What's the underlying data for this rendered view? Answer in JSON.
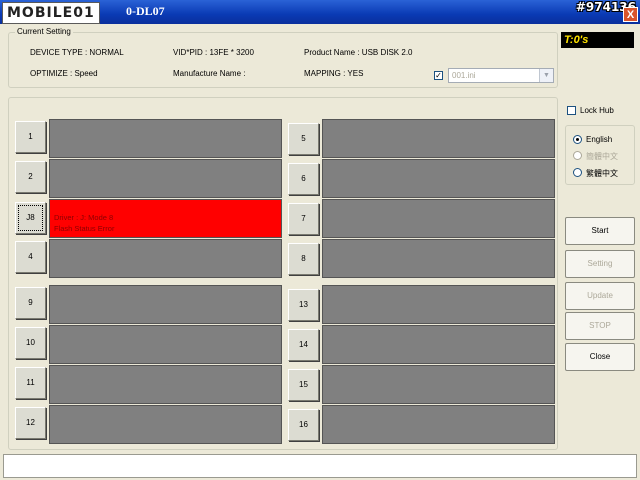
{
  "titlebar": {
    "logo_text": "MOBILE01",
    "title": "0-DL07",
    "watermark": "#974136",
    "close_label": "X"
  },
  "current_setting": {
    "legend": "Current Setting",
    "device_type": "DEVICE TYPE : NORMAL",
    "vid_pid": "VID*PID : 13FE * 3200",
    "product_name": "Product Name : USB DISK 2.0",
    "optimize": "OPTIMIZE : Speed",
    "manufacture": "Manufacture Name :",
    "mapping": "MAPPING : YES",
    "ini_checked": true,
    "ini_check_mark": "✓",
    "ini_file": "001.ini",
    "combo_arrow": "▼"
  },
  "timer": "T:0's",
  "ports_left": [
    {
      "label": "1",
      "status_lines": [
        "",
        ""
      ]
    },
    {
      "label": "2",
      "status_lines": [
        "",
        ""
      ]
    },
    {
      "label": "J8",
      "status_lines": [
        "Driver : J: Mode 8",
        "Flash Status Error"
      ],
      "error": true
    },
    {
      "label": "4",
      "status_lines": [
        "",
        ""
      ]
    },
    {
      "label": "9",
      "status_lines": [
        "",
        ""
      ]
    },
    {
      "label": "10",
      "status_lines": [
        "",
        ""
      ]
    },
    {
      "label": "11",
      "status_lines": [
        "",
        ""
      ]
    },
    {
      "label": "12",
      "status_lines": [
        "",
        ""
      ]
    }
  ],
  "ports_right": [
    {
      "label": "5"
    },
    {
      "label": "6"
    },
    {
      "label": "7"
    },
    {
      "label": "8"
    },
    {
      "label": "13"
    },
    {
      "label": "14"
    },
    {
      "label": "15"
    },
    {
      "label": "16"
    }
  ],
  "side": {
    "lock_hub": "Lock Hub",
    "lang_english": "English",
    "lang_simplified": "簡體中文",
    "lang_traditional": "繁體中文",
    "start": "Start",
    "setting": "Setting",
    "update": "Update",
    "stop": "STOP",
    "close": "Close"
  },
  "colors": {
    "error": "#ff0000",
    "idle_slot": "#808080",
    "timer_bg": "#000000",
    "timer_fg": "#ffe400"
  }
}
